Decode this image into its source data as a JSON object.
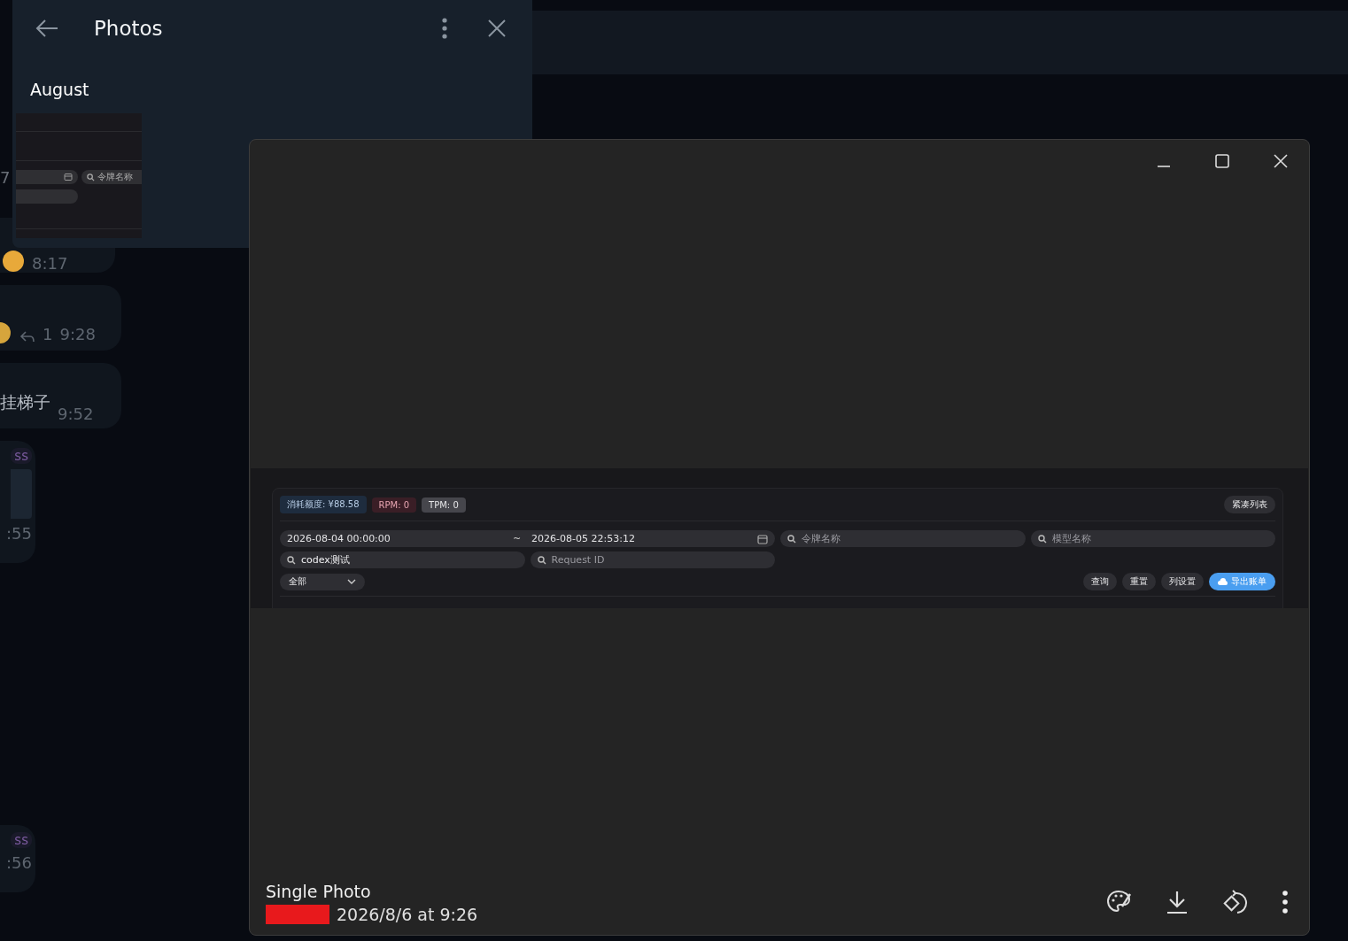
{
  "chat": {
    "fragment": "7",
    "messages": [
      {
        "kind": "emoji",
        "time": "8:17"
      },
      {
        "kind": "reply",
        "replies": "1",
        "time": "9:28"
      },
      {
        "kind": "text",
        "text": "挂梯子",
        "time": "9:52"
      },
      {
        "kind": "tagged",
        "tag": "ss",
        "time": ":55"
      },
      {
        "kind": "tag",
        "tag": "ss",
        "time": ":56"
      }
    ]
  },
  "photos_panel": {
    "title": "Photos",
    "sections": [
      {
        "heading": "August",
        "photos": [
          {
            "kind": "screenshot",
            "placeholder": "令牌名称"
          }
        ]
      }
    ]
  },
  "viewer": {
    "image": {
      "badges": [
        {
          "kind": "quota",
          "label": "消耗额度: ¥88.58"
        },
        {
          "kind": "rpm",
          "label": "RPM: 0"
        },
        {
          "kind": "tpm",
          "label": "TPM: 0"
        }
      ],
      "compact_button": "紧凑列表",
      "date_start": "2026-08-04 00:00:00",
      "date_separator": "~",
      "date_end": "2026-08-05 22:53:12",
      "fields": [
        {
          "placeholder": "令牌名称"
        },
        {
          "placeholder": "模型名称"
        },
        {
          "value": "codex测试"
        },
        {
          "placeholder": "Request ID"
        }
      ],
      "select": "全部",
      "buttons": [
        {
          "label": "查询",
          "primary": false
        },
        {
          "label": "重置",
          "primary": false
        },
        {
          "label": "列设置",
          "primary": false
        },
        {
          "label": "导出账单",
          "primary": true
        }
      ]
    },
    "caption": {
      "title": "Single Photo",
      "date": "2026/8/6 at 9:26"
    }
  }
}
